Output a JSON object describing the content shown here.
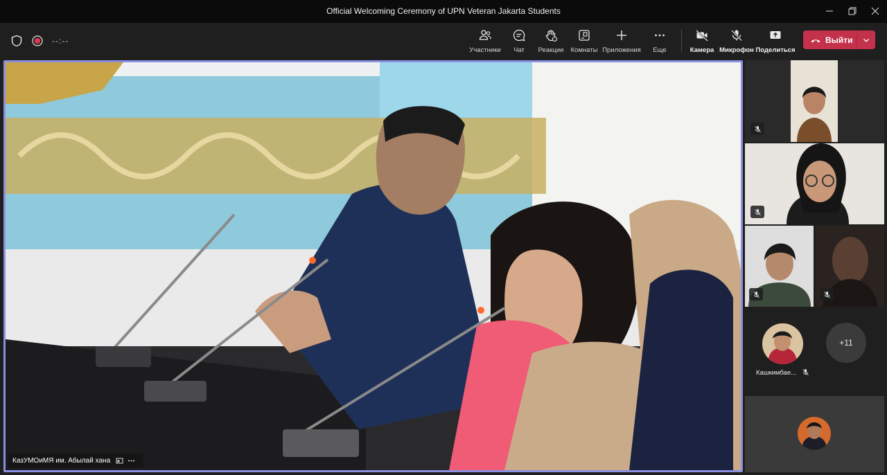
{
  "window": {
    "title": "Official Welcoming Ceremony of UPN Veteran Jakarta Students"
  },
  "toolbar": {
    "timer": "--:--",
    "participants": "Участники",
    "chat": "Чат",
    "reactions": "Реакции",
    "rooms": "Комнаты",
    "apps": "Приложения",
    "more": "Еще",
    "camera": "Камера",
    "mic": "Микрофон",
    "share": "Поделиться",
    "leave": "Выйти"
  },
  "stage": {
    "speaker_name": "КазУМОиМЯ им. Абылай хана"
  },
  "gallery": {
    "named_attendee": "Кашкимбае...",
    "overflow_count": "+11"
  },
  "colors": {
    "accent": "#8a8fe0",
    "leave": "#c4314b"
  }
}
